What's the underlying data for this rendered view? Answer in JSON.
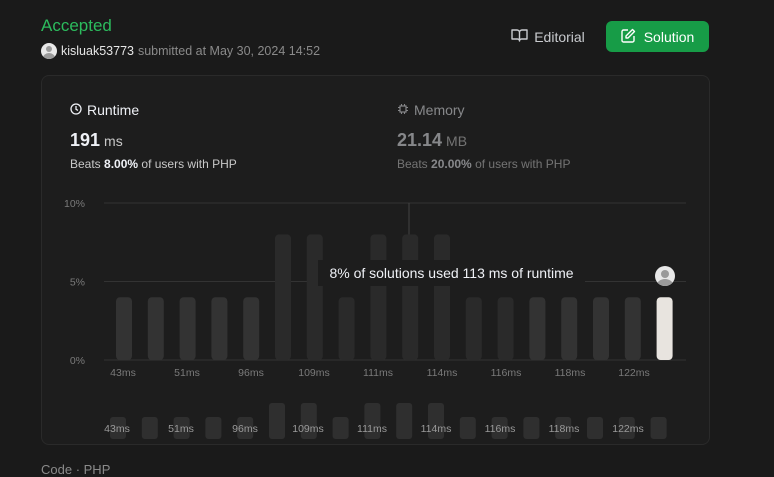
{
  "submission": {
    "status": "Accepted",
    "username": "kisluak53773",
    "submitted_text": "submitted at May 30, 2024 14:52"
  },
  "actions": {
    "editorial_label": "Editorial",
    "solution_label": "Solution",
    "editorial_icon": "book-open-icon",
    "solution_icon": "pencil-square-icon"
  },
  "runtime": {
    "label": "Runtime",
    "icon": "clock-icon",
    "value": "191",
    "unit": "ms",
    "beats_prefix": "Beats",
    "beats_pct": "8.00%",
    "beats_suffix": "of users with PHP"
  },
  "memory": {
    "label": "Memory",
    "icon": "chip-icon",
    "value": "21.14",
    "unit": "MB",
    "beats_prefix": "Beats",
    "beats_pct": "20.00%",
    "beats_suffix": "of users with PHP"
  },
  "tooltip": "8% of solutions used 113 ms of runtime",
  "chart_data": {
    "type": "bar",
    "title": "",
    "xlabel": "",
    "ylabel": "",
    "ylim": [
      0,
      10
    ],
    "y_ticks": [
      "10%",
      "5%",
      "0%"
    ],
    "x_tick_labels": [
      "43ms",
      "51ms",
      "96ms",
      "109ms",
      "111ms",
      "114ms",
      "116ms",
      "118ms",
      "122ms"
    ],
    "categories": [
      "43ms",
      "",
      "51ms",
      "",
      "96ms",
      "",
      "",
      "109ms",
      "",
      "",
      "111ms",
      "",
      "114ms",
      "",
      "",
      "116ms",
      "",
      "",
      "118ms",
      "",
      "122ms",
      ""
    ],
    "values": [
      4,
      4,
      4,
      4,
      4,
      8,
      8,
      4,
      8,
      8,
      8,
      4,
      4,
      4,
      4,
      4,
      4,
      4
    ],
    "highlighted_index": 17,
    "highlight_color": "#e8e4df",
    "bar_color": "#333333",
    "grid": true
  },
  "footer": {
    "code_label": "Code",
    "lang_label": "PHP"
  },
  "colors": {
    "accent": "#2cbb5d",
    "button": "#179c47",
    "background": "#1a1a1a"
  }
}
